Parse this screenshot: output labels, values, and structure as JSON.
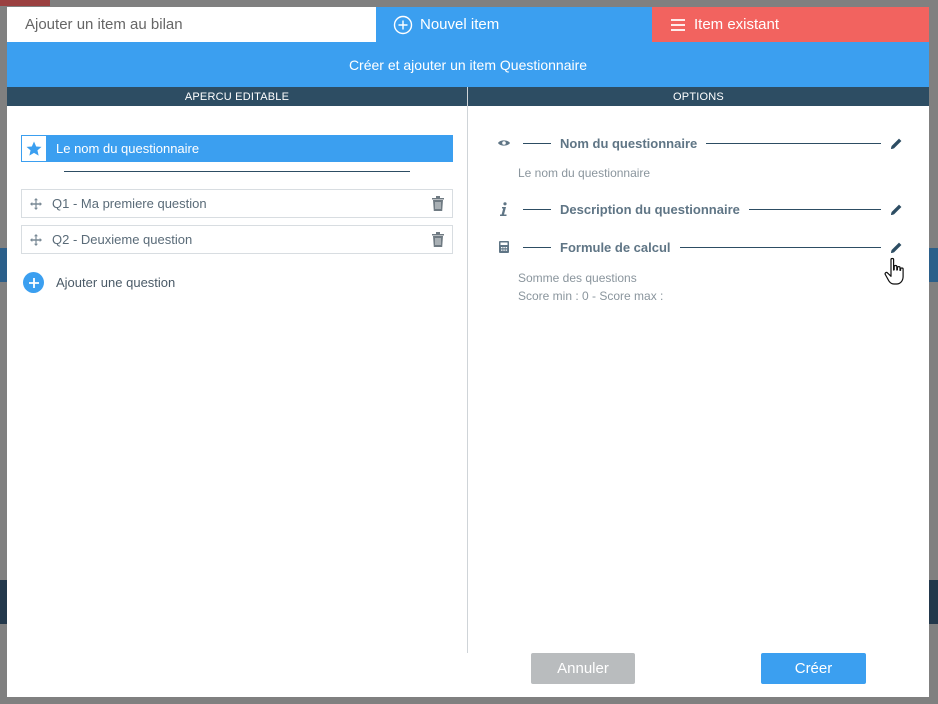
{
  "tabs": {
    "title": "Ajouter un item au bilan",
    "new_item": "Nouvel item",
    "existing_item": "Item existant"
  },
  "banner": "Créer et ajouter un item Questionnaire",
  "columns": {
    "left": "APERCU EDITABLE",
    "right": "OPTIONS"
  },
  "preview": {
    "name": "Le nom du questionnaire",
    "questions": [
      "Q1 - Ma premiere question",
      "Q2 - Deuxieme question"
    ],
    "add_question": "Ajouter une question"
  },
  "options": {
    "name_title": "Nom du questionnaire",
    "name_value": "Le nom du questionnaire",
    "description_title": "Description du questionnaire",
    "formula_title": "Formule de calcul",
    "formula_value": "Somme des questions",
    "score_value": "Score min : 0 - Score max :"
  },
  "buttons": {
    "cancel": "Annuler",
    "create": "Créer"
  },
  "colors": {
    "accent": "#3b9ff0",
    "danger": "#f2635f",
    "header_dark": "#2d4d63"
  },
  "icons": [
    "plus-circle-icon",
    "hamburger-icon",
    "star-icon",
    "move-icon",
    "trash-icon",
    "eye-icon",
    "info-icon",
    "calculator-icon",
    "pencil-icon",
    "hand-cursor-icon"
  ]
}
